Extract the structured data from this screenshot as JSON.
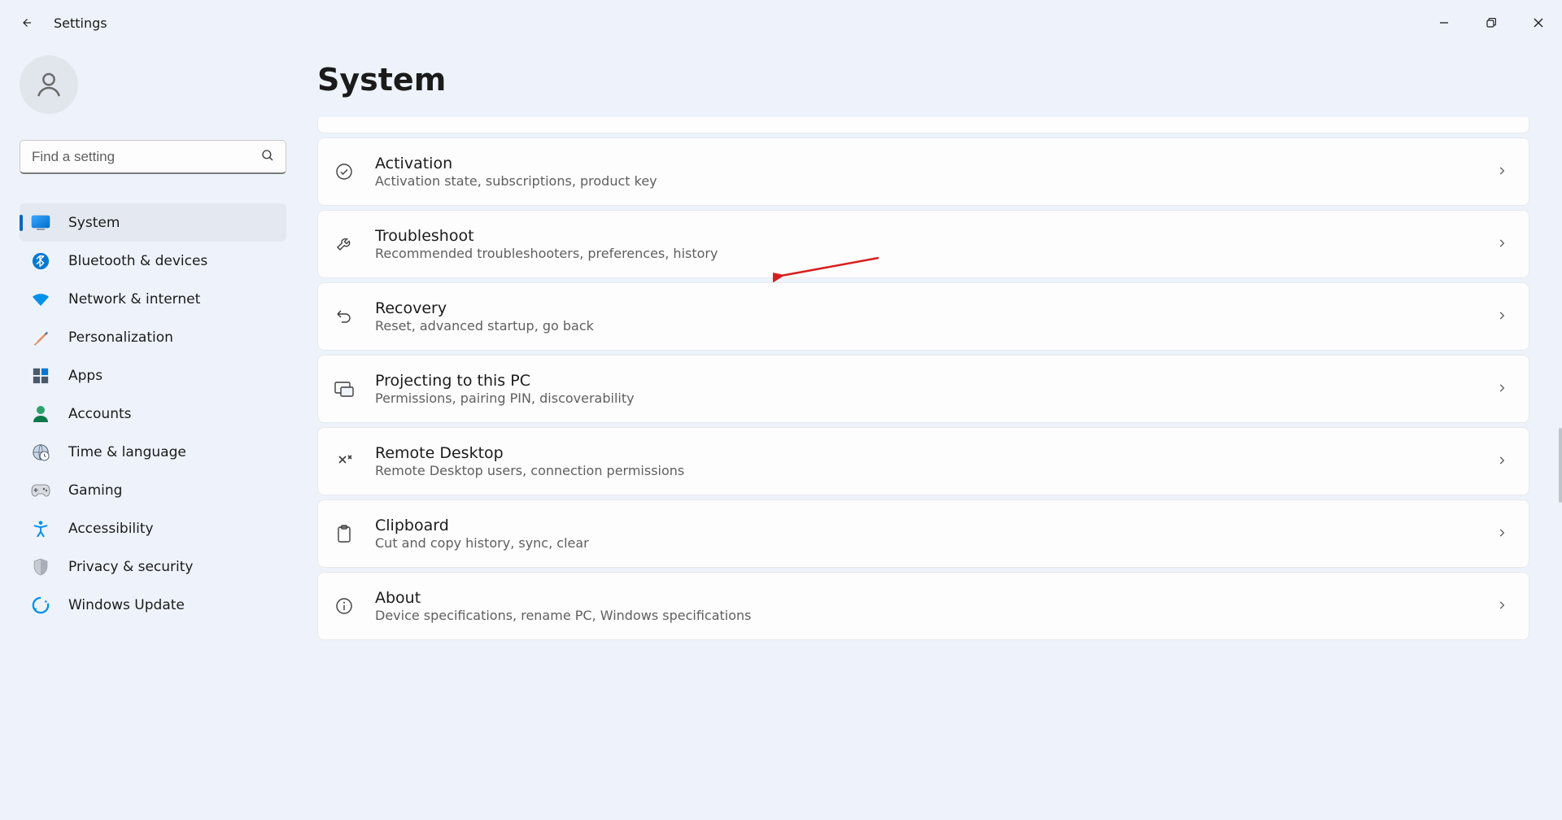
{
  "app": {
    "title": "Settings"
  },
  "search": {
    "placeholder": "Find a setting"
  },
  "page": {
    "title": "System"
  },
  "sidebar": {
    "items": [
      {
        "label": "System"
      },
      {
        "label": "Bluetooth & devices"
      },
      {
        "label": "Network & internet"
      },
      {
        "label": "Personalization"
      },
      {
        "label": "Apps"
      },
      {
        "label": "Accounts"
      },
      {
        "label": "Time & language"
      },
      {
        "label": "Gaming"
      },
      {
        "label": "Accessibility"
      },
      {
        "label": "Privacy & security"
      },
      {
        "label": "Windows Update"
      }
    ]
  },
  "rows": [
    {
      "title": "Activation",
      "sub": "Activation state, subscriptions, product key"
    },
    {
      "title": "Troubleshoot",
      "sub": "Recommended troubleshooters, preferences, history"
    },
    {
      "title": "Recovery",
      "sub": "Reset, advanced startup, go back"
    },
    {
      "title": "Projecting to this PC",
      "sub": "Permissions, pairing PIN, discoverability"
    },
    {
      "title": "Remote Desktop",
      "sub": "Remote Desktop users, connection permissions"
    },
    {
      "title": "Clipboard",
      "sub": "Cut and copy history, sync, clear"
    },
    {
      "title": "About",
      "sub": "Device specifications, rename PC, Windows specifications"
    }
  ]
}
